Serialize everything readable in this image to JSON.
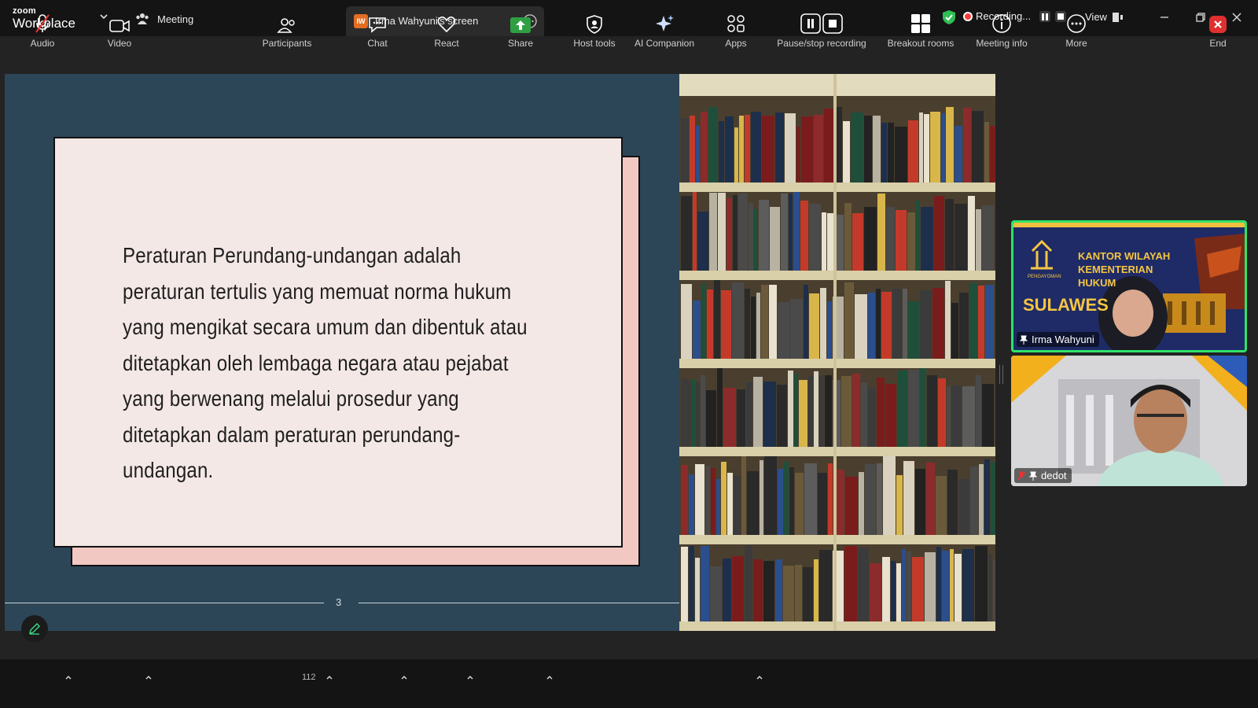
{
  "app": {
    "logo_top": "zoom",
    "logo_bottom": "Workplace"
  },
  "tabs": {
    "meeting": "Meeting",
    "screen_share": "Irma Wahyuni's screen",
    "screen_share_initials": "IW"
  },
  "status": {
    "recording": "Recording...",
    "view": "View"
  },
  "slide": {
    "text": "Peraturan Perundang-undangan adalah peraturan tertulis yang memuat norma hukum yang mengikat secara umum dan dibentuk atau ditetapkan oleh lembaga negara atau pejabat yang berwenang melalui prosedur yang ditetapkan dalam peraturan perundang-undangan.",
    "page_number": "3"
  },
  "participants_videos": [
    {
      "name": "Irma Wahyuni",
      "banner_lines": [
        "KANTOR WILAYAH",
        "KEMENTERIAN",
        "HUKUM"
      ],
      "banner_big": "SULAWES",
      "logo_caption": "PENGAYOMAN"
    },
    {
      "name": "dedot"
    }
  ],
  "toolbar": {
    "audio": "Audio",
    "video": "Video",
    "participants": "Participants",
    "participants_count": "112",
    "chat": "Chat",
    "react": "React",
    "share": "Share",
    "host_tools": "Host tools",
    "ai_companion": "AI Companion",
    "apps": "Apps",
    "pause_stop_recording": "Pause/stop recording",
    "breakout_rooms": "Breakout rooms",
    "meeting_info": "Meeting info",
    "more": "More",
    "end": "End"
  },
  "colors": {
    "active_speaker_border": "#2fe36a",
    "share_green": "#2ea043",
    "end_red": "#e02f2f",
    "slide_bg": "#2c4657"
  }
}
